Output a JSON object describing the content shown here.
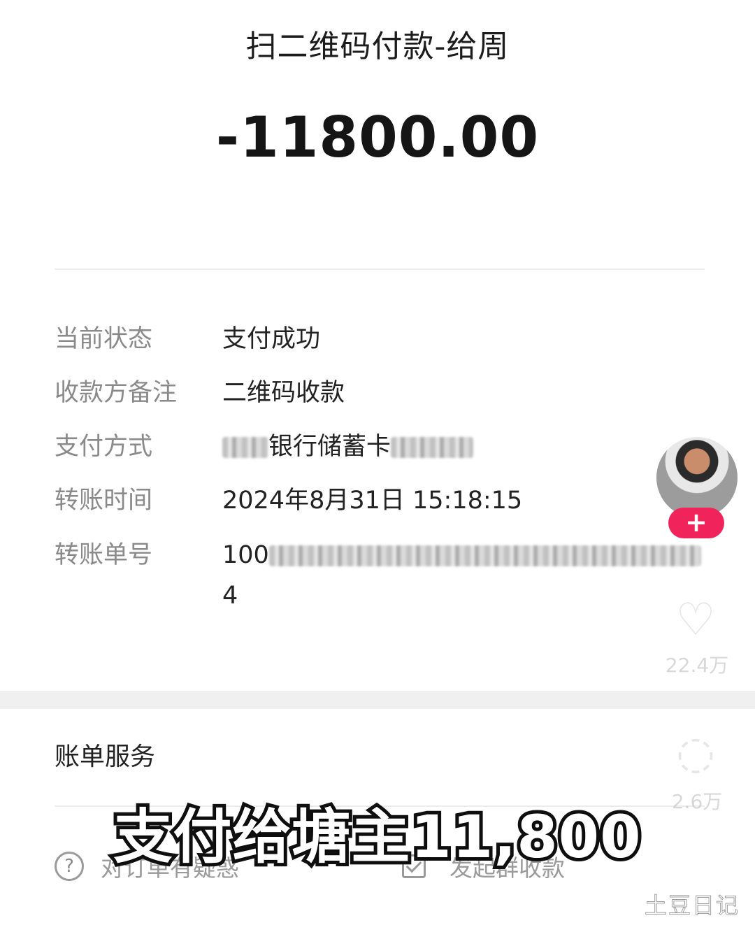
{
  "header": {
    "title": "扫二维码付款-给周",
    "amount": "-11800.00"
  },
  "details": [
    {
      "label": "当前状态",
      "value": "支付成功"
    },
    {
      "label": "收款方备注",
      "value": "二维码收款"
    },
    {
      "label": "支付方式",
      "value": "银行储蓄卡"
    },
    {
      "label": "转账时间",
      "value": "2024年8月31日 15:18:15"
    },
    {
      "label": "转账单号",
      "value_prefix": "100",
      "value_line2": "4"
    }
  ],
  "bill_service": {
    "title": "账单服务",
    "question_label": "对订单有疑惑",
    "group_label": "发起群收款"
  },
  "overlay": {
    "caption": "支付给塘主11,800",
    "like_count": "22.4万",
    "comment_count": "2.6万",
    "watermark": "土豆日记",
    "plus_symbol": "+",
    "accent_color": "#f0245a"
  }
}
